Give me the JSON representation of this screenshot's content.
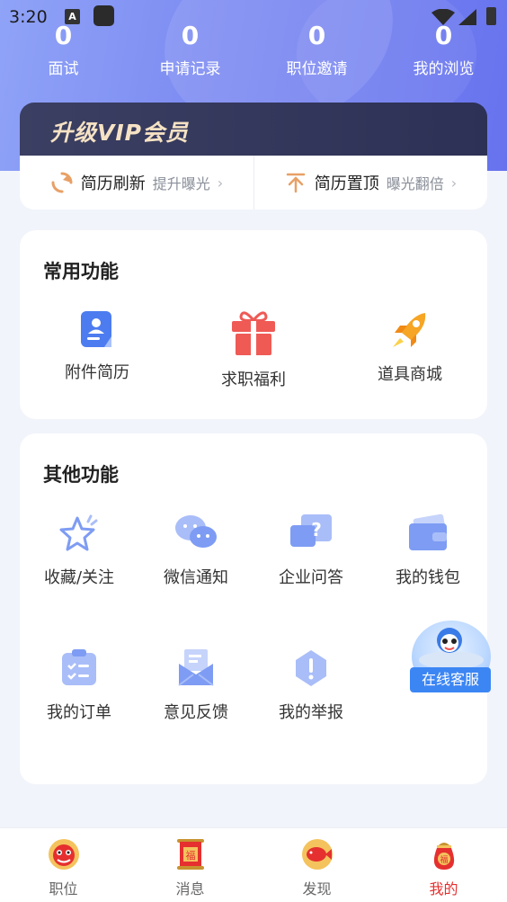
{
  "status_bar": {
    "time": "3:20",
    "notif_letter": "A"
  },
  "stats": [
    {
      "num": "0",
      "label": "面试"
    },
    {
      "num": "0",
      "label": "申请记录"
    },
    {
      "num": "0",
      "label": "职位邀请"
    },
    {
      "num": "0",
      "label": "我的浏览"
    }
  ],
  "vip": {
    "title": "升级VIP会员"
  },
  "actions": [
    {
      "title": "简历刷新",
      "sub": "提升曝光",
      "chevron": "›",
      "icon": "refresh-icon"
    },
    {
      "title": "简历置顶",
      "sub": "曝光翻倍",
      "chevron": "›",
      "icon": "pin-top-icon"
    }
  ],
  "common": {
    "title": "常用功能",
    "items": [
      {
        "label": "附件简历",
        "icon": "attachment-resume-icon"
      },
      {
        "label": "求职福利",
        "icon": "gift-icon"
      },
      {
        "label": "道具商城",
        "icon": "rocket-icon"
      }
    ]
  },
  "other": {
    "title": "其他功能",
    "items": [
      {
        "label": "收藏/关注",
        "icon": "star-icon"
      },
      {
        "label": "微信通知",
        "icon": "wechat-icon"
      },
      {
        "label": "企业问答",
        "icon": "qa-icon"
      },
      {
        "label": "我的钱包",
        "icon": "wallet-icon"
      },
      {
        "label": "我的订单",
        "icon": "order-icon"
      },
      {
        "label": "意见反馈",
        "icon": "feedback-icon"
      },
      {
        "label": "我的举报",
        "icon": "report-icon"
      }
    ]
  },
  "customer_service": {
    "label": "在线客服"
  },
  "nav": [
    {
      "label": "职位",
      "icon": "lion-dance-icon",
      "active": false
    },
    {
      "label": "消息",
      "icon": "fu-scroll-icon",
      "active": false
    },
    {
      "label": "发现",
      "icon": "koi-icon",
      "active": false
    },
    {
      "label": "我的",
      "icon": "lucky-bag-icon",
      "active": true
    }
  ],
  "colors": {
    "accent": "#6773ee",
    "active_nav": "#e5302f",
    "vip_text": "#f6e2c4"
  }
}
